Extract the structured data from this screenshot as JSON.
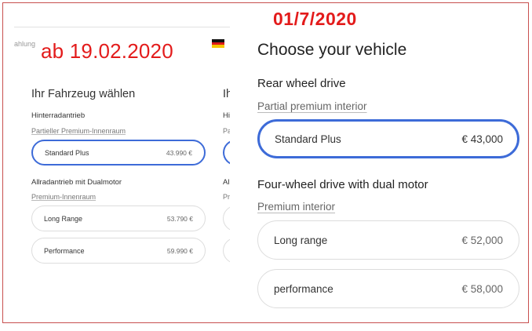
{
  "labels": {
    "old_date": "ab 19.02.2020",
    "new_date": "01/7/2020"
  },
  "colors": {
    "annotation_red": "#e31b1b",
    "selected_blue": "#3d6bd8"
  },
  "german": {
    "nav_fragment": "ahlung",
    "flag_icon": "germany-flag-icon",
    "title": "Ihr Fahrzeug wählen",
    "title_fragment": "Ih",
    "sections": [
      {
        "heading": "Hinterradantrieb",
        "heading_fragment": "Hi",
        "interior": "Partieller Premium-Innenraum",
        "interior_fragment": "Pa",
        "options": [
          {
            "name": "Standard Plus",
            "price": "43.990 €",
            "selected": true
          }
        ]
      },
      {
        "heading": "Allradantrieb mit Dualmotor",
        "heading_fragment": "Al",
        "interior": "Premium-Innenraum",
        "interior_fragment": "Pr",
        "options": [
          {
            "name": "Long Range",
            "price": "53.790 €",
            "selected": false
          },
          {
            "name": "Performance",
            "price": "59.990 €",
            "selected": false
          }
        ]
      }
    ]
  },
  "english": {
    "title": "Choose your vehicle",
    "sections": [
      {
        "heading": "Rear wheel drive",
        "interior": "Partial premium interior",
        "options": [
          {
            "name": "Standard Plus",
            "price": "€ 43,000",
            "selected": true
          }
        ]
      },
      {
        "heading": "Four-wheel drive with dual motor",
        "interior": "Premium interior",
        "options": [
          {
            "name": "Long range",
            "price": "€ 52,000",
            "selected": false
          },
          {
            "name": "performance",
            "price": "€ 58,000",
            "selected": false
          }
        ]
      }
    ]
  }
}
